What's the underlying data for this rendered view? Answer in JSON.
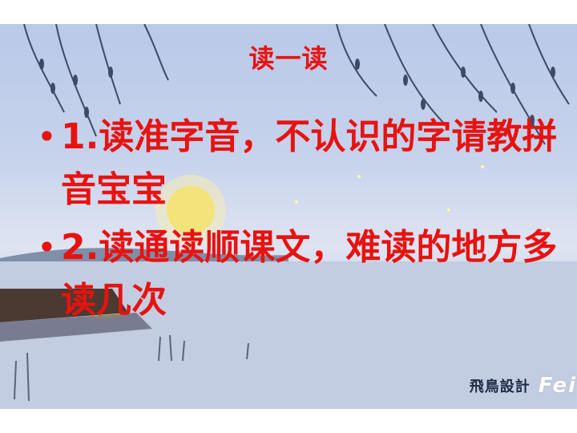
{
  "slide": {
    "title": "读一读",
    "bullets": [
      {
        "marker": "•",
        "text": "1.读准字音，不认识的字请教拼音宝宝"
      },
      {
        "marker": "•",
        "text": "2.读通读顺课文，难读的地方多读几次"
      }
    ],
    "watermark": {
      "cn": "飛鳥設計",
      "en": "Fei"
    }
  },
  "colors": {
    "text": "#e8120f",
    "sky": "#c7d3ec",
    "moon": "#f4e27a"
  }
}
